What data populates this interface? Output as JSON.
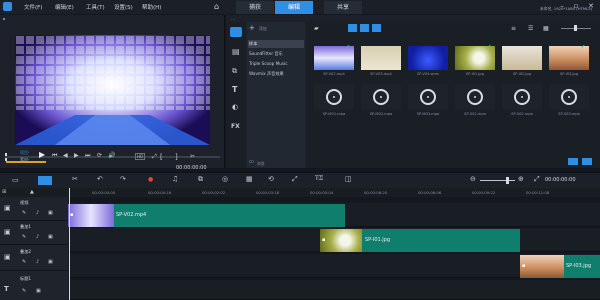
{
  "menu": [
    "文件(F)",
    "编辑(E)",
    "工具(T)",
    "设置(S)",
    "帮助(H)"
  ],
  "tabs": [
    "捕获",
    "编辑",
    "共享"
  ],
  "project_info": [
    "未命名, 1920*1080 (HTML5)"
  ],
  "library": {
    "add_label": "添加",
    "folders": [
      "样本",
      "SoundFitter 音乐",
      "Triple Scoop Music",
      "Wavmix 声音效果"
    ],
    "browse_label": "浏览",
    "video_items": [
      {
        "label": "SP-V02.mp4"
      },
      {
        "label": "SP-V03.mp4"
      },
      {
        "label": "SP-V04.wmv"
      },
      {
        "label": "SP-I01.jpg"
      },
      {
        "label": "SP-I02.jpg"
      },
      {
        "label": "SP-I03.jpg"
      }
    ],
    "audio_items": [
      {
        "label": "SP-M01.mpa"
      },
      {
        "label": "SP-M02.mpa"
      },
      {
        "label": "SP-M03.mpa"
      },
      {
        "label": "SP-S01.mpa"
      },
      {
        "label": "SP-S02.mpa"
      },
      {
        "label": "SP-S03.mpa"
      }
    ]
  },
  "preview": {
    "mode_labels": [
      "项目-",
      "素材-"
    ],
    "timecode": "00:00:00:00",
    "quality": "HD"
  },
  "timeline": {
    "ruler_ticks": [
      "00:00:00:00",
      "00:00:00:16",
      "00:00:02:02",
      "00:00:03:18",
      "00:00:05:04",
      "00:00:06:20",
      "00:00:08:06",
      "00:00:09:22",
      "00:00:11:08"
    ],
    "tracks": [
      "视频",
      "叠加1",
      "叠加2",
      "标题1"
    ],
    "clips": [
      {
        "label": "SP-V02.mp4"
      },
      {
        "label": "SP-I01.jpg"
      },
      {
        "label": "SP-I03.jpg"
      }
    ]
  },
  "colors": {
    "accent": "#2f8fe6",
    "clip": "#0f7e6c",
    "bg": "#14181e"
  }
}
